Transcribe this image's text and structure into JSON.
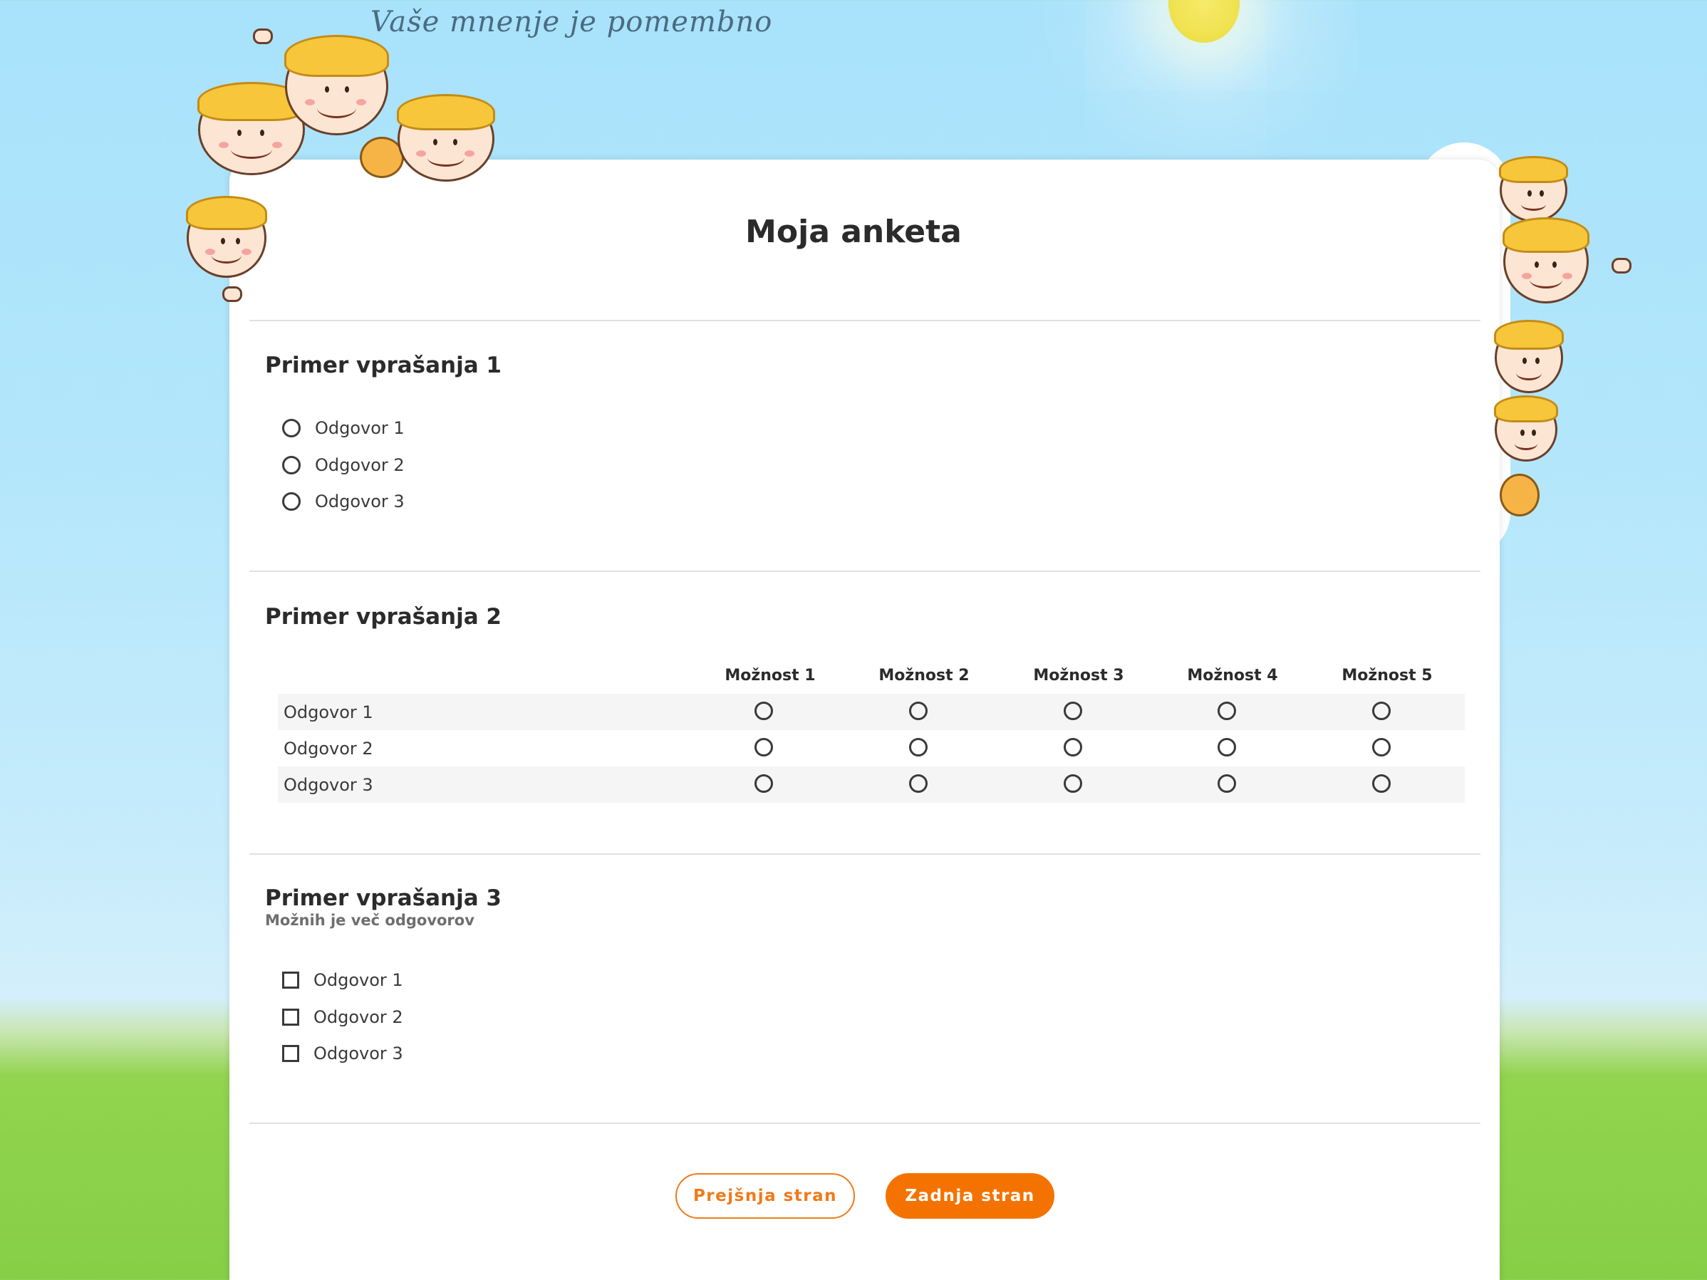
{
  "header": {
    "tagline": "Vaše mnenje je pomembno"
  },
  "survey": {
    "title": "Moja anketa"
  },
  "question1": {
    "title": "Primer vprašanja 1",
    "options": [
      "Odgovor 1",
      "Odgovor 2",
      "Odgovor 3"
    ]
  },
  "question2": {
    "title": "Primer vprašanja 2",
    "columns": [
      "Možnost 1",
      "Možnost 2",
      "Možnost 3",
      "Možnost 4",
      "Možnost 5"
    ],
    "rows": [
      "Odgovor 1",
      "Odgovor 2",
      "Odgovor 3"
    ]
  },
  "question3": {
    "title": "Primer vprašanja 3",
    "subtitle": "Možnih je več odgovorov",
    "options": [
      "Odgovor 1",
      "Odgovor 2",
      "Odgovor 3"
    ]
  },
  "navigation": {
    "prev_label": "Prejšnja stran",
    "next_label": "Zadnja stran"
  },
  "colors": {
    "accent": "#f47300",
    "sky": "#a8e2fb",
    "grass": "#86cf46"
  },
  "icons": {
    "decor_left": "cartoon-kids-icon",
    "decor_right": "cartoon-kids-icon",
    "sun": "sun-icon"
  }
}
